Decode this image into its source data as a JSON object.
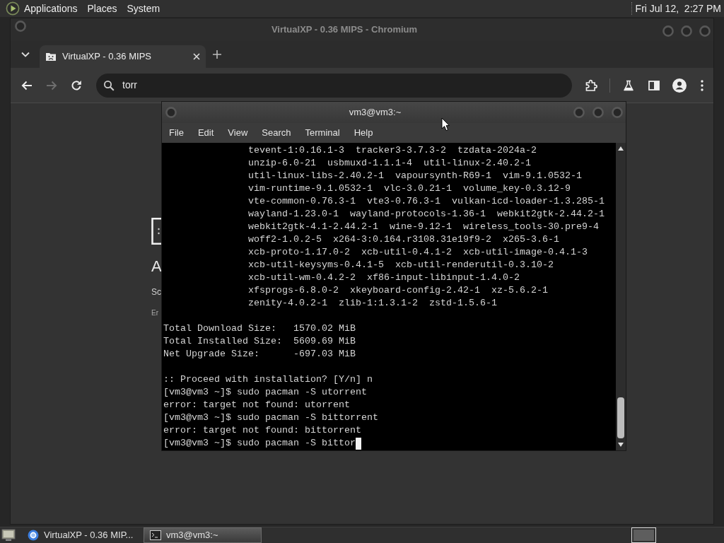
{
  "top_panel": {
    "menus": [
      "Applications",
      "Places",
      "System"
    ],
    "clock": "Fri Jul 12,  2:27 PM"
  },
  "browser": {
    "title": "VirtualXP - 0.36 MIPS - Chromium",
    "tabs": [
      {
        "label": "VirtualXP - 0.36 MIPS",
        "selected": true
      }
    ],
    "nav_buttons": [
      {
        "kind": "back",
        "disabled": false
      },
      {
        "kind": "forward",
        "disabled": true
      },
      {
        "kind": "reload",
        "disabled": false
      }
    ],
    "address_bar": {
      "value": "torr"
    },
    "page": {
      "fragments": [
        {
          "kind": "heading",
          "text": "A"
        },
        {
          "kind": "text",
          "text": "Sc"
        },
        {
          "kind": "caption",
          "text": "Er"
        }
      ]
    }
  },
  "terminal": {
    "title": "vm3@vm3:~",
    "menus": [
      "File",
      "Edit",
      "View",
      "Search",
      "Terminal",
      "Help"
    ],
    "blocks": [
      {
        "kind": "continuation",
        "lines": [
          "tevent-1:0.16.1-3  tracker3-3.7.3-2  tzdata-2024a-2",
          "unzip-6.0-21  usbmuxd-1.1.1-4  util-linux-2.40.2-1",
          "util-linux-libs-2.40.2-1  vapoursynth-R69-1  vim-9.1.0532-1",
          "vim-runtime-9.1.0532-1  vlc-3.0.21-1  volume_key-0.3.12-9",
          "vte-common-0.76.3-1  vte3-0.76.3-1  vulkan-icd-loader-1.3.285-1",
          "wayland-1.23.0-1  wayland-protocols-1.36-1  webkit2gtk-2.44.2-1",
          "webkit2gtk-4.1-2.44.2-1  wine-9.12-1  wireless_tools-30.pre9-4",
          "woff2-1.0.2-5  x264-3:0.164.r3108.31e19f9-2  x265-3.6-1",
          "xcb-proto-1.17.0-2  xcb-util-0.4.1-2  xcb-util-image-0.4.1-3",
          "xcb-util-keysyms-0.4.1-5  xcb-util-renderutil-0.3.10-2",
          "xcb-util-wm-0.4.2-2  xf86-input-libinput-1.4.0-2",
          "xfsprogs-6.8.0-2  xkeyboard-config-2.42-1  xz-5.6.2-1",
          "zenity-4.0.2-1  zlib-1:1.3.1-2  zstd-1.5.6-1"
        ]
      },
      {
        "kind": "plain",
        "lines": [
          "Total Download Size:   1570.02 MiB",
          "Total Installed Size:  5609.69 MiB",
          "Net Upgrade Size:      -697.03 MiB"
        ]
      },
      {
        "kind": "plain",
        "lines": [
          ":: Proceed with installation? [Y/n] n",
          "[vm3@vm3 ~]$ sudo pacman -S utorrent",
          "error: target not found: utorrent",
          "[vm3@vm3 ~]$ sudo pacman -S bittorrent",
          "error: target not found: bittorrent",
          "[vm3@vm3 ~]$ sudo pacman -S bittor"
        ]
      }
    ],
    "cursor": true
  },
  "taskbar": {
    "tasks": [
      {
        "kind": "browser",
        "label": "VirtualXP - 0.36 MIP...",
        "selected": false
      },
      {
        "kind": "terminal",
        "label": "vm3@vm3:~",
        "selected": true
      }
    ]
  }
}
